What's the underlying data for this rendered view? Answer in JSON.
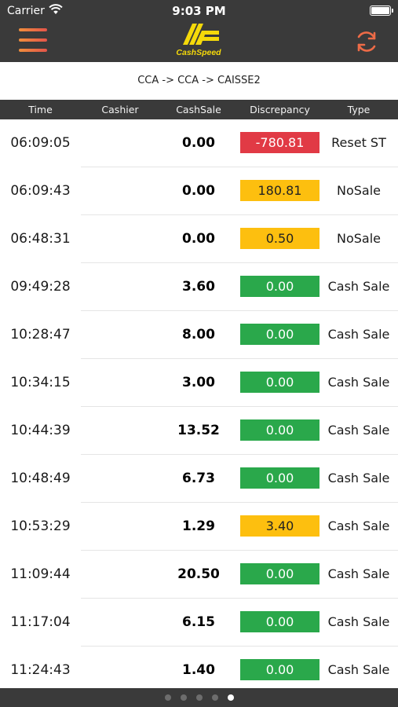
{
  "status_bar": {
    "carrier": "Carrier",
    "time": "9:03 PM",
    "wifi_icon": "wifi-icon",
    "battery_icon": "battery-full-icon"
  },
  "nav_bar": {
    "menu_icon": "hamburger-menu-icon",
    "logo_text": "CashSpeed",
    "refresh_icon": "refresh-icon",
    "accent_color": "#ed6b47",
    "logo_color": "#f5d90a"
  },
  "breadcrumb": "CCA -> CCA -> CAISSE2",
  "table": {
    "headers": [
      "Time",
      "Cashier",
      "CashSale",
      "Discrepancy",
      "Type"
    ],
    "rows": [
      {
        "time": "06:09:05",
        "cashier": "",
        "cash_sale": "0.00",
        "discrepancy": "-780.81",
        "status": "red",
        "type": "Reset ST"
      },
      {
        "time": "06:09:43",
        "cashier": "",
        "cash_sale": "0.00",
        "discrepancy": "180.81",
        "status": "yellow",
        "type": "NoSale"
      },
      {
        "time": "06:48:31",
        "cashier": "",
        "cash_sale": "0.00",
        "discrepancy": "0.50",
        "status": "yellow",
        "type": "NoSale"
      },
      {
        "time": "09:49:28",
        "cashier": "",
        "cash_sale": "3.60",
        "discrepancy": "0.00",
        "status": "green",
        "type": "Cash Sale"
      },
      {
        "time": "10:28:47",
        "cashier": "",
        "cash_sale": "8.00",
        "discrepancy": "0.00",
        "status": "green",
        "type": "Cash Sale"
      },
      {
        "time": "10:34:15",
        "cashier": "",
        "cash_sale": "3.00",
        "discrepancy": "0.00",
        "status": "green",
        "type": "Cash Sale"
      },
      {
        "time": "10:44:39",
        "cashier": "",
        "cash_sale": "13.52",
        "discrepancy": "0.00",
        "status": "green",
        "type": "Cash Sale"
      },
      {
        "time": "10:48:49",
        "cashier": "",
        "cash_sale": "6.73",
        "discrepancy": "0.00",
        "status": "green",
        "type": "Cash Sale"
      },
      {
        "time": "10:53:29",
        "cashier": "",
        "cash_sale": "1.29",
        "discrepancy": "3.40",
        "status": "yellow",
        "type": "Cash Sale"
      },
      {
        "time": "11:09:44",
        "cashier": "",
        "cash_sale": "20.50",
        "discrepancy": "0.00",
        "status": "green",
        "type": "Cash Sale"
      },
      {
        "time": "11:17:04",
        "cashier": "",
        "cash_sale": "6.15",
        "discrepancy": "0.00",
        "status": "green",
        "type": "Cash Sale"
      },
      {
        "time": "11:24:43",
        "cashier": "",
        "cash_sale": "1.40",
        "discrepancy": "0.00",
        "status": "green",
        "type": "Cash Sale"
      }
    ],
    "status_colors": {
      "red": "#e13a45",
      "yellow": "#fdbf0f",
      "green": "#2aa84b"
    }
  },
  "pager": {
    "total": 5,
    "active": 5
  }
}
